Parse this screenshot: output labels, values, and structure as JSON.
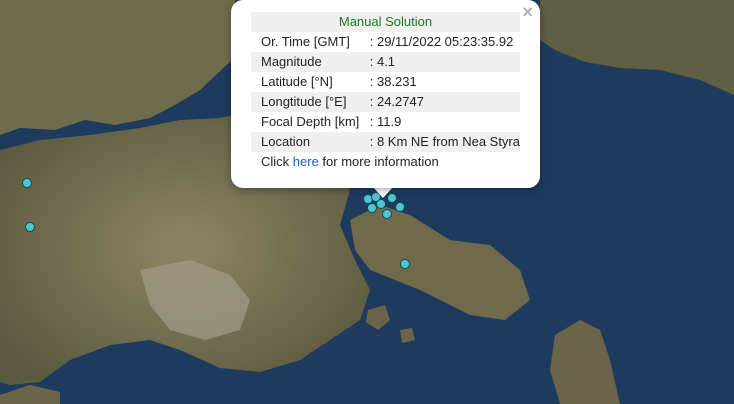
{
  "popup": {
    "title": "Manual Solution",
    "close_icon": "×",
    "rows": [
      {
        "label": "Or. Time [GMT]",
        "value": ": 29/11/2022 05:23:35.92"
      },
      {
        "label": "Magnitude",
        "value": ": 4.1"
      },
      {
        "label": "Latitude [°N]",
        "value": ": 38.231"
      },
      {
        "label": "Longtitude [°E]",
        "value": ": 24.2747"
      },
      {
        "label": "Focal Depth [km]",
        "value": ": 11.9"
      },
      {
        "label": "Location",
        "value": ": 8 Km NE from Nea Styra"
      }
    ],
    "more": {
      "prefix": "Click ",
      "link": "here",
      "suffix": " for more information"
    }
  },
  "colors": {
    "marker": "#4fc6cf",
    "link": "#1b5fb8",
    "title": "#1a7a1a"
  }
}
